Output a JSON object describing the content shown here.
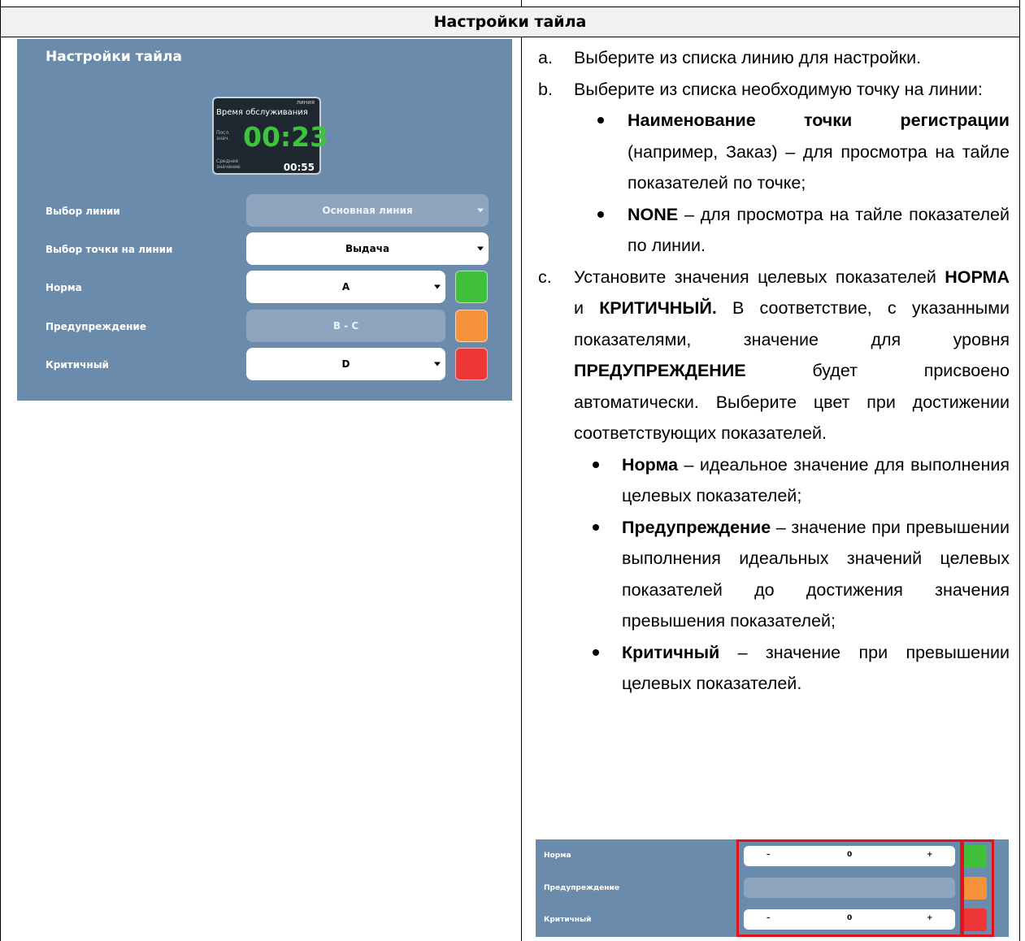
{
  "header": {
    "title": "Настройки тайла"
  },
  "panel": {
    "title": "Настройки тайла",
    "tile": {
      "line_tag": "линия",
      "title": "Время обслуживания",
      "last_label_1": "Посл.",
      "last_label_2": "знач.",
      "last_value": "00:23",
      "avg_label_1": "Среднее",
      "avg_label_2": "значение",
      "avg_value": "00:55"
    },
    "rows": {
      "line": {
        "label": "Выбор линии",
        "value": "Основная линия"
      },
      "point": {
        "label": "Выбор точки на линии",
        "value": "Выдача"
      },
      "norm": {
        "label": "Норма",
        "value": "A"
      },
      "warning": {
        "label": "Предупреждение",
        "value": "B - C"
      },
      "critical": {
        "label": "Критичный",
        "value": "D"
      }
    },
    "colors": {
      "norm": "#3fbf3a",
      "warning": "#f5923a",
      "critical": "#ee3636",
      "panel_bg": "#6b8bac"
    }
  },
  "text": {
    "a_mark": "a.",
    "a_text": "Выберите из списка линию для настройки.",
    "b_mark": "b.",
    "b_text": "Выберите из списка необходимую точку на линии:",
    "b1_bold": "Наименование точки регистрации",
    "b1_rest": " (например, Заказ) – для просмотра на тайле показателей по точке;",
    "b2_bold": "NONE",
    "b2_rest": " – для просмотра на тайле показателей по линии.",
    "c_mark": "c.",
    "c_t1": "Установите значения целевых показателей ",
    "c_b1": "НОРМА",
    "c_t2": " и ",
    "c_b2": "КРИТИЧНЫЙ.",
    "c_t3": " В соответствие, с указанными показателями, значение для уровня ",
    "c_b3": "ПРЕДУПРЕЖДЕНИЕ",
    "c_t4": " будет присвоено автоматически. Выберите цвет при достижении соответствующих показателей.",
    "c1_bold": "Норма",
    "c1_rest": " – идеальное значение для выполнения целевых показателей;",
    "c2_bold": "Предупреждение",
    "c2_rest": " – значение при превышении выполнения идеальных значений целевых показателей до достижения значения превышения показателей;",
    "c3_bold": "Критичный",
    "c3_rest": " – значение при превышении целевых показателей."
  },
  "shot2": {
    "norm_label": "Норма",
    "warning_label": "Предупреждение",
    "critical_label": "Критичный",
    "minus": "–",
    "plus": "+",
    "norm_value": "0",
    "critical_value": "0",
    "highlight_color": "#e0151a"
  }
}
